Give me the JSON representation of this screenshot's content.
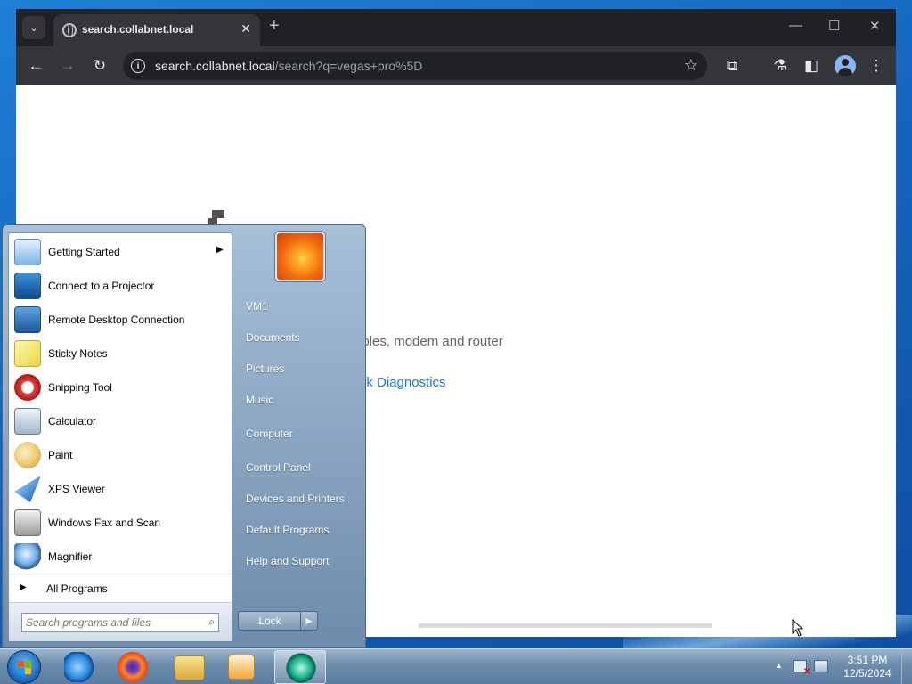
{
  "browser": {
    "tab_title": "search.collabnet.local",
    "url_host": "search.collabnet.local",
    "url_path": "/search?q=vegas+pro%5D",
    "page": {
      "error_line_fragment": "ables, modem and router",
      "error_link_fragment": "ork Diagnostics"
    }
  },
  "start_menu": {
    "programs": [
      {
        "label": "Getting Started",
        "icon": "getting-started-icon",
        "has_submenu": true
      },
      {
        "label": "Connect to a Projector",
        "icon": "projector-icon"
      },
      {
        "label": "Remote Desktop Connection",
        "icon": "remote-desktop-icon"
      },
      {
        "label": "Sticky Notes",
        "icon": "sticky-notes-icon"
      },
      {
        "label": "Snipping Tool",
        "icon": "snipping-tool-icon"
      },
      {
        "label": "Calculator",
        "icon": "calculator-icon"
      },
      {
        "label": "Paint",
        "icon": "paint-icon"
      },
      {
        "label": "XPS Viewer",
        "icon": "xps-viewer-icon"
      },
      {
        "label": "Windows Fax and Scan",
        "icon": "fax-scan-icon"
      },
      {
        "label": "Magnifier",
        "icon": "magnifier-icon"
      }
    ],
    "all_programs": "All Programs",
    "search_placeholder": "Search programs and files",
    "right_links": [
      "VM1",
      "Documents",
      "Pictures",
      "Music",
      "Computer",
      "Control Panel",
      "Devices and Printers",
      "Default Programs",
      "Help and Support"
    ],
    "lock_label": "Lock"
  },
  "taskbar": {
    "pinned": [
      "internet-explorer-icon",
      "firefox-icon",
      "file-explorer-icon",
      "media-player-icon",
      "active-app-icon"
    ],
    "clock_time": "3:51 PM",
    "clock_date": "12/5/2024"
  },
  "colors": {
    "chrome_dark": "#202124",
    "link_blue": "#1a73e8",
    "desktop_blue": "#1565bd"
  }
}
